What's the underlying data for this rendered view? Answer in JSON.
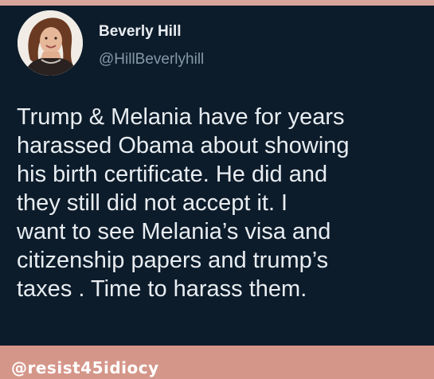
{
  "colors": {
    "background": "#0d1c2b",
    "text": "#e8edf1",
    "handle": "#8697a6",
    "accent_footer": "#d5968a"
  },
  "tweet": {
    "author": {
      "display_name": "Beverly Hill",
      "handle": "@HillBeverlyhill",
      "avatar_icon": "profile-photo"
    },
    "text_lines": [
      "Trump & Melania have for years",
      "harassed Obama about showing",
      "his birth certificate. He did and",
      "they still did not accept it. I",
      "want to see Melania’s visa and",
      "citizenship papers and trump’s",
      "taxes . Time to harass them."
    ]
  },
  "footer": {
    "watermark": "@resist45idiocy"
  }
}
